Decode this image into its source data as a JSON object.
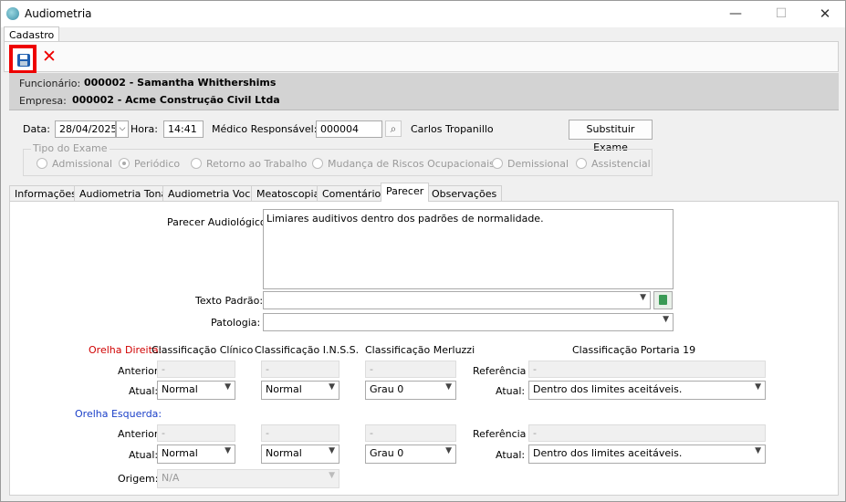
{
  "window": {
    "title": "Audiometria",
    "min": "—",
    "max": "☐",
    "close": "✕"
  },
  "ribbon": {
    "tab": "Cadastro"
  },
  "header": {
    "funcionario_label": "Funcionário:",
    "funcionario_value": "000002 - Samantha Whithershims",
    "empresa_label": "Empresa:",
    "empresa_value": "000002 - Acme Construção Civil Ltda"
  },
  "form": {
    "data_label": "Data:",
    "data_value": "28/04/2025",
    "hora_label": "Hora:",
    "hora_value": "14:41",
    "medico_label": "Médico Responsável:",
    "medico_code": "000004",
    "medico_name": "Carlos Tropanillo",
    "substituir_label": "Substituir Exame"
  },
  "tipo_exame": {
    "legend": "Tipo do Exame",
    "options": [
      "Admissional",
      "Periódico",
      "Retorno ao Trabalho",
      "Mudança de Riscos Ocupacionais",
      "Demissional",
      "Assistencial"
    ],
    "selected": "Periódico"
  },
  "tabs": [
    "Informações",
    "Audiometria Tonal",
    "Audiometria Vocal",
    "Meatoscopia",
    "Comentários",
    "Parecer",
    "Observações"
  ],
  "active_tab": "Parecer",
  "parecer": {
    "parecer_label": "Parecer Audiológico:",
    "parecer_text": "Limiares auditivos dentro dos padrões de normalidade.",
    "texto_padrao_label": "Texto Padrão:",
    "texto_padrao_value": "",
    "patologia_label": "Patologia:",
    "patologia_value": ""
  },
  "classificacao": {
    "orelha_direita": "Orelha Direita:",
    "orelha_esquerda": "Orelha Esquerda:",
    "col_clinico": "Classificação Clínico",
    "col_inss": "Classificação I.N.S.S.",
    "col_merluzzi": "Classificação Merluzzi",
    "col_portaria": "Classificação Portaria 19",
    "anterior_label": "Anterior:",
    "atual_label": "Atual:",
    "referencia_label": "Referência",
    "dash": "-",
    "direita": {
      "clinico": "Normal",
      "inss": "Normal",
      "merluzzi": "Grau 0",
      "portaria": "Dentro dos limites aceitáveis."
    },
    "esquerda": {
      "clinico": "Normal",
      "inss": "Normal",
      "merluzzi": "Grau 0",
      "portaria": "Dentro dos limites aceitáveis."
    },
    "origem_label": "Origem:",
    "origem_value": "N/A"
  },
  "icons": {
    "dropdown": "▼",
    "lookup": "⌕",
    "date": "⌵"
  }
}
